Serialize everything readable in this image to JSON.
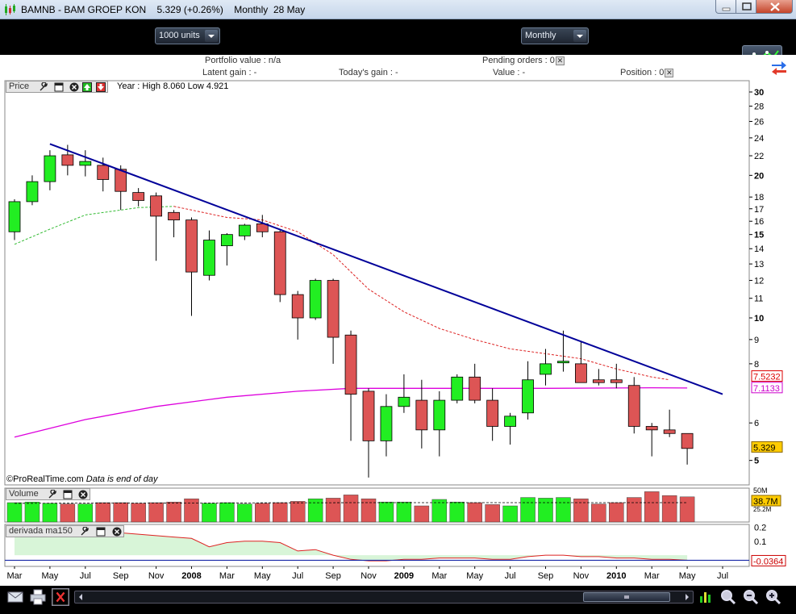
{
  "window": {
    "title": "BAMNB - BAM GROEP KON",
    "last_price": "5.329",
    "change": "(+0.26%)",
    "period": "Monthly",
    "date": "28 May"
  },
  "toolbar": {
    "units_value": "1000 units",
    "period_value": "Monthly"
  },
  "portfolio": {
    "portfolio_value": "Portfolio value : n/a",
    "pending_orders": "Pending orders : 0",
    "latent_gain": "Latent gain : -",
    "todays_gain": "Today's gain : -",
    "value": "Value : -",
    "position": "Position : 0"
  },
  "price_panel": {
    "label": "Price",
    "year_info": "Year : High 8.060 Low 4.921",
    "footer_brand": "©ProRealTime.com",
    "footer_note": "Data is end of day",
    "tag_line": "7.5232",
    "tag_ma_long": "7.1133",
    "tag_last": "5.329",
    "colors": {
      "up": "#22ee22",
      "down": "#dd5555",
      "trendline": "#000099",
      "ma_short": "#dd2222",
      "ma_mid": "#33bb33",
      "ma_long": "#dd00dd"
    }
  },
  "volume_panel": {
    "label": "Volume",
    "tag_high": "50M",
    "tag_value": "38.7M",
    "tag_low": "25.2M"
  },
  "indicator_panel": {
    "label": "derivada ma150",
    "tag_value": "-0.0364"
  },
  "chart_data": {
    "type": "candlestick",
    "scale": "log",
    "price_axis_ticks": [
      5,
      6,
      8,
      9,
      10,
      11,
      12,
      13,
      14,
      15,
      16,
      17,
      18,
      20,
      22,
      24,
      26,
      28,
      30
    ],
    "price_axis_bold": [
      5,
      10,
      15,
      20,
      30
    ],
    "ylim": [
      4.5,
      31.5
    ],
    "x_labels": [
      "Mar",
      "May",
      "Jul",
      "Sep",
      "Nov",
      "2008",
      "Mar",
      "May",
      "Jul",
      "Sep",
      "Nov",
      "2009",
      "Mar",
      "May",
      "Jul",
      "Sep",
      "Nov",
      "2010",
      "Mar",
      "May",
      "Jul"
    ],
    "x_labels_bold": [
      "2008",
      "2009",
      "2010"
    ],
    "months": [
      "2007-03",
      "2007-04",
      "2007-05",
      "2007-06",
      "2007-07",
      "2007-08",
      "2007-09",
      "2007-10",
      "2007-11",
      "2007-12",
      "2008-01",
      "2008-02",
      "2008-03",
      "2008-04",
      "2008-05",
      "2008-06",
      "2008-07",
      "2008-08",
      "2008-09",
      "2008-10",
      "2008-11",
      "2008-12",
      "2009-01",
      "2009-02",
      "2009-03",
      "2009-04",
      "2009-05",
      "2009-06",
      "2009-07",
      "2009-08",
      "2009-09",
      "2009-10",
      "2009-11",
      "2009-12",
      "2010-01",
      "2010-02",
      "2010-03",
      "2010-04",
      "2010-05"
    ],
    "ohlc": [
      [
        15.2,
        17.8,
        14.6,
        17.6
      ],
      [
        17.6,
        20.0,
        17.3,
        19.4
      ],
      [
        19.4,
        22.6,
        18.6,
        22.0
      ],
      [
        22.1,
        23.2,
        20.0,
        21.0
      ],
      [
        21.0,
        22.6,
        19.9,
        21.4
      ],
      [
        21.0,
        21.8,
        18.5,
        19.6
      ],
      [
        20.6,
        21.0,
        16.9,
        18.5
      ],
      [
        18.4,
        18.8,
        17.2,
        17.7
      ],
      [
        18.1,
        18.4,
        13.2,
        16.4
      ],
      [
        16.7,
        16.9,
        14.8,
        16.1
      ],
      [
        16.1,
        16.3,
        10.1,
        12.5
      ],
      [
        12.3,
        15.3,
        12.0,
        14.6
      ],
      [
        14.2,
        15.1,
        12.9,
        15.0
      ],
      [
        14.9,
        15.8,
        14.6,
        15.7
      ],
      [
        15.8,
        16.5,
        14.8,
        15.2
      ],
      [
        15.2,
        15.3,
        10.8,
        11.2
      ],
      [
        11.2,
        11.4,
        9.0,
        10.0
      ],
      [
        10.0,
        12.1,
        9.9,
        12.0
      ],
      [
        12.0,
        12.1,
        8.0,
        9.1
      ],
      [
        9.2,
        9.4,
        5.5,
        6.9
      ],
      [
        7.0,
        7.1,
        4.6,
        5.5
      ],
      [
        5.5,
        6.9,
        5.1,
        6.5
      ],
      [
        6.5,
        7.6,
        6.3,
        6.8
      ],
      [
        6.7,
        7.4,
        5.3,
        5.8
      ],
      [
        5.8,
        7.0,
        5.1,
        6.7
      ],
      [
        6.7,
        7.6,
        6.6,
        7.5
      ],
      [
        7.5,
        8.0,
        6.6,
        6.7
      ],
      [
        6.7,
        7.1,
        5.5,
        5.9
      ],
      [
        5.9,
        6.3,
        5.4,
        6.2
      ],
      [
        6.3,
        8.1,
        6.1,
        7.4
      ],
      [
        7.6,
        8.6,
        7.2,
        8.0
      ],
      [
        8.1,
        9.4,
        7.7,
        8.1
      ],
      [
        8.0,
        8.9,
        7.3,
        7.3
      ],
      [
        7.4,
        7.8,
        7.2,
        7.3
      ],
      [
        7.4,
        8.0,
        7.1,
        7.3
      ],
      [
        7.2,
        7.5,
        5.7,
        5.9
      ],
      [
        5.9,
        6.0,
        5.1,
        5.8
      ],
      [
        5.8,
        6.4,
        5.6,
        5.7
      ],
      [
        5.7,
        5.7,
        4.9,
        5.3
      ]
    ],
    "trendline": {
      "from": [
        "2007-05",
        23.3
      ],
      "to": [
        "2010-07",
        6.9
      ]
    },
    "ma_mid_green": [
      [
        0,
        14.3
      ],
      [
        2,
        15.4
      ],
      [
        4,
        16.5
      ],
      [
        7,
        17.1
      ],
      [
        9,
        17.2
      ]
    ],
    "ma_short_red": [
      [
        9,
        17.2
      ],
      [
        10,
        16.9
      ],
      [
        12,
        16.3
      ],
      [
        14,
        16.1
      ],
      [
        16,
        15.2
      ],
      [
        18,
        13.6
      ],
      [
        20,
        11.5
      ],
      [
        22,
        10.3
      ],
      [
        24,
        9.5
      ],
      [
        26,
        9.0
      ],
      [
        28,
        8.6
      ],
      [
        30,
        8.4
      ],
      [
        32,
        8.2
      ],
      [
        34,
        7.8
      ],
      [
        36,
        7.5
      ],
      [
        37,
        7.4
      ]
    ],
    "ma_long_magenta": [
      [
        0,
        5.6
      ],
      [
        4,
        6.1
      ],
      [
        8,
        6.5
      ],
      [
        12,
        6.8
      ],
      [
        16,
        7.0
      ],
      [
        19,
        7.1
      ],
      [
        24,
        7.1
      ],
      [
        30,
        7.1
      ],
      [
        36,
        7.12
      ],
      [
        38,
        7.11
      ]
    ],
    "volume": [
      30,
      31,
      29,
      28,
      28,
      30,
      30,
      29,
      30,
      31,
      36,
      29,
      30,
      28,
      29,
      30,
      32,
      36,
      37,
      42,
      36,
      31,
      31,
      25,
      35,
      31,
      30,
      27,
      25,
      38,
      37,
      38,
      36,
      28,
      30,
      38,
      47,
      41,
      39
    ],
    "volume_ylim": [
      0,
      50
    ],
    "indicator_ticks": [
      0.2,
      0.1
    ],
    "indicator_ylim": [
      -0.08,
      0.22
    ],
    "indicator": [
      0.19,
      0.19,
      0.18,
      0.18,
      0.18,
      0.17,
      0.16,
      0.15,
      0.14,
      0.13,
      0.12,
      0.06,
      0.09,
      0.1,
      0.1,
      0.09,
      0.03,
      0.04,
      0.0,
      -0.03,
      -0.04,
      -0.04,
      -0.03,
      -0.03,
      -0.02,
      -0.02,
      -0.02,
      -0.03,
      -0.03,
      -0.01,
      0.0,
      0.0,
      -0.01,
      -0.01,
      -0.02,
      -0.02,
      -0.03,
      -0.03,
      -0.036
    ]
  }
}
